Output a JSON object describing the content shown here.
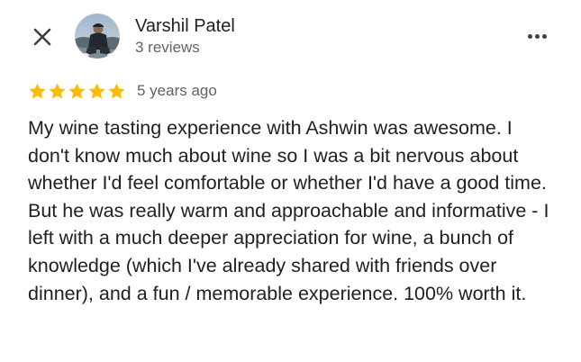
{
  "review": {
    "author_name": "Varshil Patel",
    "author_review_count": "3 reviews",
    "rating": 5,
    "rating_max": 5,
    "time_ago": "5 years ago",
    "text": "My wine tasting experience with Ashwin was awesome. I don't know much about wine so I was a bit nervous about whether I'd feel comfortable or whether I'd have a good time. But he was really warm and approachable and informative - I left with a much deeper appreciation for wine, a bunch of knowledge (which I've already shared with friends over dinner), and a fun / memorable experience. 100% worth it."
  },
  "icons": {
    "close": "close-icon",
    "more": "more-horizontal-icon",
    "star": "star-icon"
  },
  "colors": {
    "star": "#fbbc04",
    "text_primary": "#202124",
    "text_secondary": "#5f6368"
  }
}
